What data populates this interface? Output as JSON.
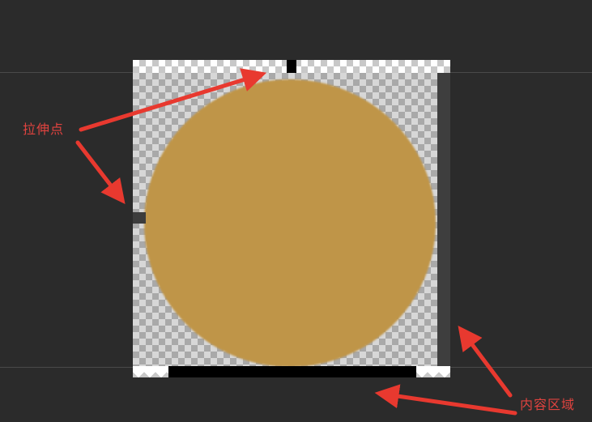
{
  "annotations": {
    "stretch_label": "拉伸点",
    "content_label": "内容区域",
    "arrow_color": "#e8392f"
  },
  "image": {
    "circle_color": "#bf9548",
    "background_color": "#2b2b2b"
  }
}
